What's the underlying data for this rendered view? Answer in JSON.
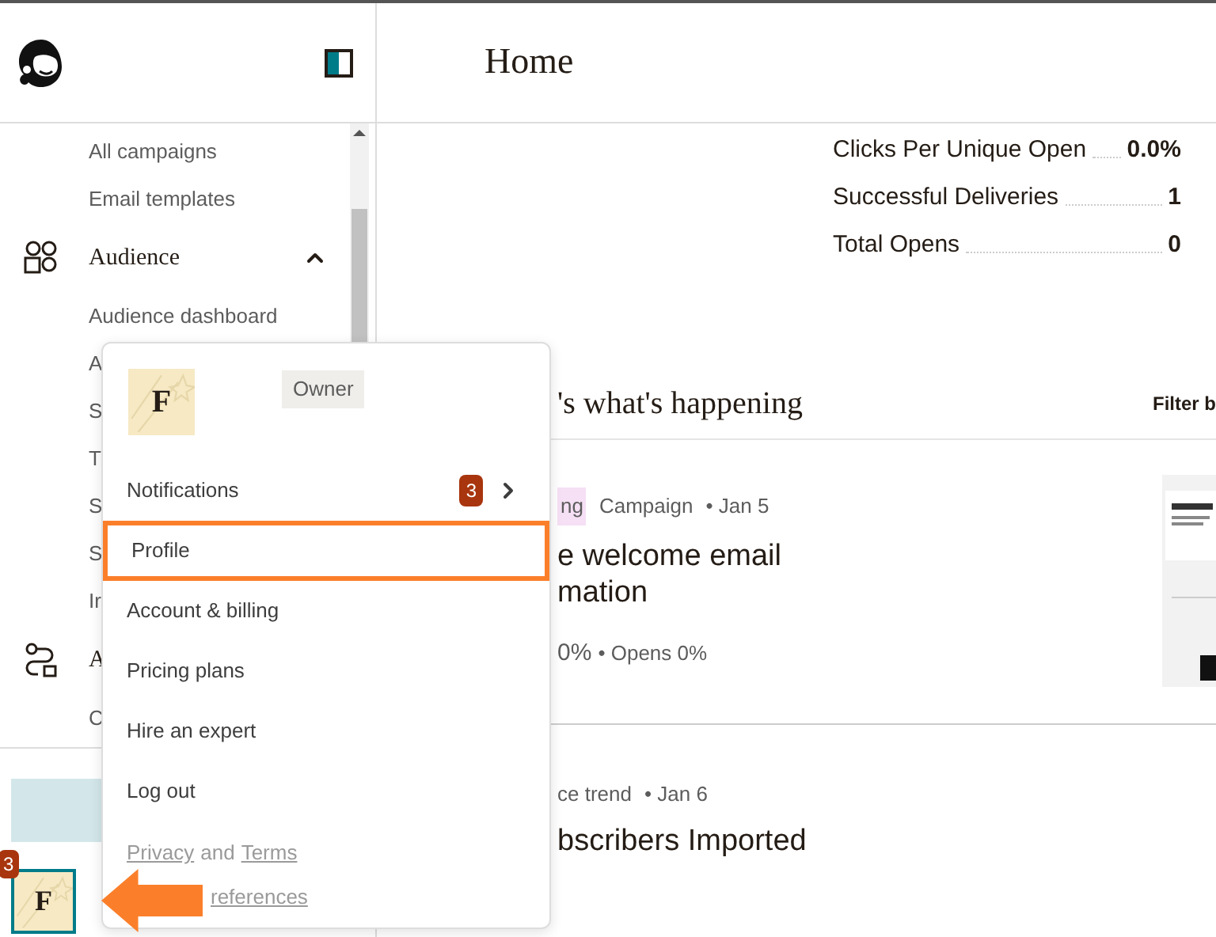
{
  "header": {
    "title": "Home"
  },
  "sidebar": {
    "items": [
      {
        "label": "All campaigns",
        "kind": "sub"
      },
      {
        "label": "Email templates",
        "kind": "sub"
      },
      {
        "label": "Audience",
        "kind": "section",
        "expanded": true
      },
      {
        "label": "Audience dashboard",
        "kind": "sub"
      },
      {
        "label": "A",
        "kind": "sub"
      },
      {
        "label": "S",
        "kind": "sub"
      },
      {
        "label": "T",
        "kind": "sub"
      },
      {
        "label": "S",
        "kind": "sub"
      },
      {
        "label": "S",
        "kind": "sub"
      },
      {
        "label": "Ir",
        "kind": "sub"
      },
      {
        "label": "A",
        "kind": "section"
      },
      {
        "label": "C",
        "kind": "sub"
      }
    ],
    "account": {
      "avatar_letter": "F",
      "badge": "3"
    }
  },
  "stats": [
    {
      "label": "Clicks Per Unique Open",
      "value": "0.0%"
    },
    {
      "label": "Successful Deliveries",
      "value": "1"
    },
    {
      "label": "Total Opens",
      "value": "0"
    }
  ],
  "feed": {
    "heading": "'s what's happening",
    "filter": "Filter b",
    "cards": [
      {
        "tag": "ng",
        "type": "Campaign",
        "date": "• Jan 5",
        "title_lines": [
          "e welcome email",
          "mation"
        ],
        "metric": "0%",
        "metric_2": "• Opens 0%"
      },
      {
        "type": "ce trend",
        "date": "• Jan 6",
        "title_lines": [
          "bscribers Imported"
        ]
      }
    ]
  },
  "account_menu": {
    "avatar_letter": "F",
    "role": "Owner",
    "items": [
      {
        "label": "Notifications",
        "badge": "3",
        "highlighted": false
      },
      {
        "label": "Profile",
        "highlighted": true
      },
      {
        "label": "Account & billing",
        "highlighted": false
      },
      {
        "label": "Pricing plans",
        "highlighted": false
      },
      {
        "label": "Hire an expert",
        "highlighted": false
      },
      {
        "label": "Log out",
        "highlighted": false
      }
    ],
    "footer_links": [
      "Privacy",
      "and",
      "Terms"
    ],
    "footer_link_2": "references"
  }
}
